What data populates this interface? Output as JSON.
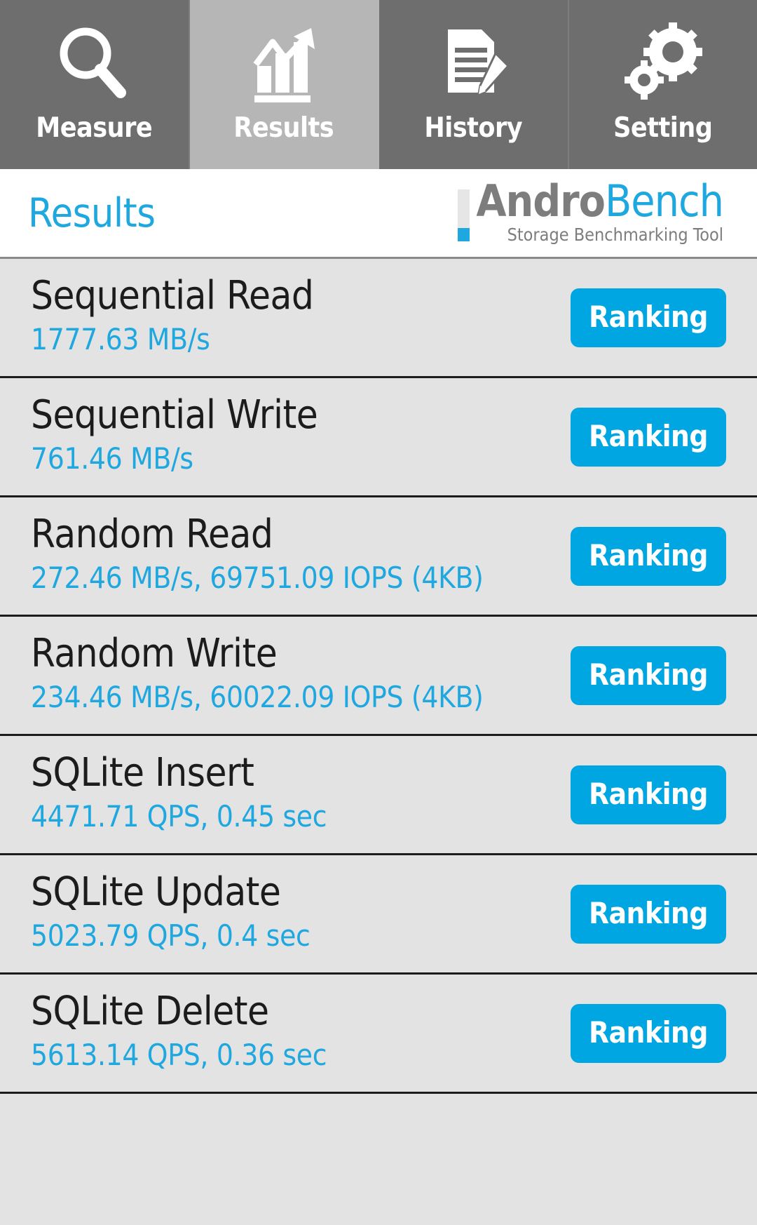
{
  "tabs": [
    {
      "label": "Measure",
      "icon": "magnifier-icon",
      "selected": false
    },
    {
      "label": "Results",
      "icon": "bar-chart-arrow-icon",
      "selected": true
    },
    {
      "label": "History",
      "icon": "document-pencil-icon",
      "selected": false
    },
    {
      "label": "Setting",
      "icon": "gears-icon",
      "selected": false
    }
  ],
  "header": {
    "title": "Results",
    "logo_primary": "Andro",
    "logo_secondary": "Bench",
    "logo_tagline": "Storage Benchmarking Tool"
  },
  "colors": {
    "accent": "#00a6e2",
    "value_text": "#1fa8e0",
    "tab_bg": "#6e6e6e",
    "tab_selected_bg": "#b6b6b6",
    "row_bg": "#e3e3e3",
    "logo_gray": "#7d7d7d"
  },
  "results": {
    "ranking_label": "Ranking",
    "rows": [
      {
        "name": "Sequential Read",
        "value": "1777.63 MB/s"
      },
      {
        "name": "Sequential Write",
        "value": "761.46 MB/s"
      },
      {
        "name": "Random Read",
        "value": "272.46 MB/s, 69751.09 IOPS (4KB)"
      },
      {
        "name": "Random Write",
        "value": "234.46 MB/s, 60022.09 IOPS (4KB)"
      },
      {
        "name": "SQLite Insert",
        "value": "4471.71 QPS, 0.45 sec"
      },
      {
        "name": "SQLite Update",
        "value": "5023.79 QPS, 0.4 sec"
      },
      {
        "name": "SQLite Delete",
        "value": "5613.14 QPS, 0.36 sec"
      }
    ]
  }
}
